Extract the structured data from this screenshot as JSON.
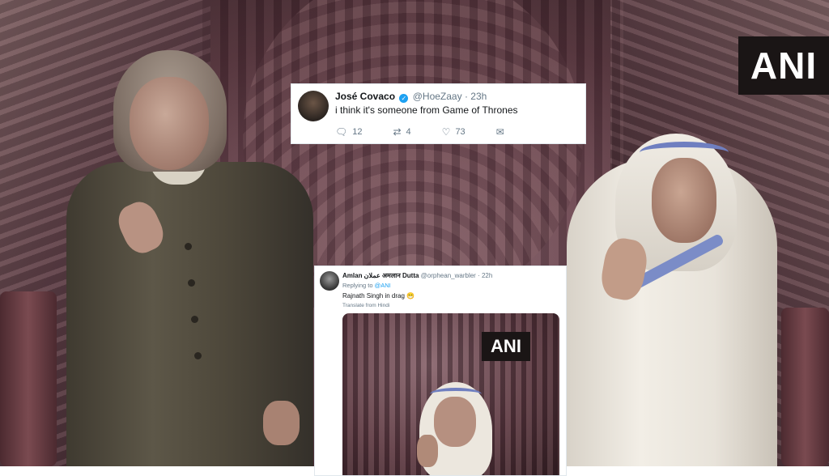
{
  "watermark": "ANI",
  "tweet1": {
    "name": "José Covaco",
    "handle": "@HoeZaay",
    "time": "23h",
    "text": "i think it's someone from Game of Thrones",
    "replies": "12",
    "retweets": "4",
    "likes": "73",
    "icons": [
      "reply-icon",
      "retweet-icon",
      "like-icon",
      "message-icon"
    ]
  },
  "tweet2": {
    "name": "Amlan عملان अमलान Dutta",
    "handle": "@orphean_warbler",
    "time": "22h",
    "reply_prefix": "Replying to",
    "reply_to": "@ANI",
    "text": "Rajnath Singh in drag 😁",
    "translate": "Translate from Hindi",
    "media_watermark": "ANI"
  },
  "colors": {
    "verified": "#1da1f2",
    "link": "#1da1f2",
    "muted": "#657786"
  }
}
